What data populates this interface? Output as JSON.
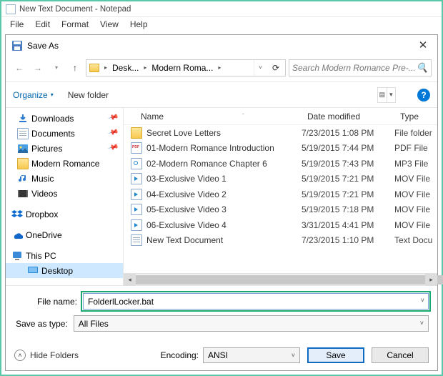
{
  "notepad": {
    "title": "New Text Document - Notepad",
    "menu": [
      "File",
      "Edit",
      "Format",
      "View",
      "Help"
    ]
  },
  "dialog": {
    "title": "Save As",
    "nav": {
      "path_segments": [
        "Desk...",
        "Modern Roma..."
      ],
      "search_placeholder": "Search Modern Romance Pre-..."
    },
    "toolbar": {
      "organize": "Organize",
      "new_folder": "New folder"
    },
    "sidebar": {
      "quick": [
        {
          "label": "Downloads",
          "icon": "download",
          "pinned": true
        },
        {
          "label": "Documents",
          "icon": "doc",
          "pinned": true
        },
        {
          "label": "Pictures",
          "icon": "pic",
          "pinned": true
        },
        {
          "label": "Modern Romance",
          "icon": "folder",
          "pinned": false
        },
        {
          "label": "Music",
          "icon": "music",
          "pinned": false
        },
        {
          "label": "Videos",
          "icon": "video",
          "pinned": false
        }
      ],
      "cloud": [
        {
          "label": "Dropbox",
          "icon": "dropbox"
        },
        {
          "label": "OneDrive",
          "icon": "onedrive"
        }
      ],
      "thispc": {
        "label": "This PC"
      },
      "desktop": {
        "label": "Desktop"
      }
    },
    "columns": {
      "name": "Name",
      "date": "Date modified",
      "type": "Type"
    },
    "files": [
      {
        "name": "Secret Love Letters",
        "date": "7/23/2015 1:08 PM",
        "type": "File folder",
        "kind": "folder"
      },
      {
        "name": "01-Modern Romance Introduction",
        "date": "5/19/2015 7:44 PM",
        "type": "PDF File",
        "kind": "pdf"
      },
      {
        "name": "02-Modern Romance Chapter 6",
        "date": "5/19/2015 7:43 PM",
        "type": "MP3 File",
        "kind": "mp3"
      },
      {
        "name": "03-Exclusive Video 1",
        "date": "5/19/2015 7:21 PM",
        "type": "MOV File",
        "kind": "mov"
      },
      {
        "name": "04-Exclusive Video 2",
        "date": "5/19/2015 7:21 PM",
        "type": "MOV File",
        "kind": "mov"
      },
      {
        "name": "05-Exclusive Video 3",
        "date": "5/19/2015 7:18 PM",
        "type": "MOV File",
        "kind": "mov"
      },
      {
        "name": "06-Exclusive Video 4",
        "date": "3/31/2015 4:41 PM",
        "type": "MOV File",
        "kind": "mov"
      },
      {
        "name": "New Text Document",
        "date": "7/23/2015 1:10 PM",
        "type": "Text Docu",
        "kind": "txt"
      }
    ],
    "form": {
      "filename_label": "File name:",
      "filename_value": "FolderlLocker.bat",
      "saveastype_label": "Save as type:",
      "saveastype_value": "All Files",
      "hide_folders": "Hide Folders",
      "encoding_label": "Encoding:",
      "encoding_value": "ANSI",
      "save": "Save",
      "cancel": "Cancel"
    }
  }
}
